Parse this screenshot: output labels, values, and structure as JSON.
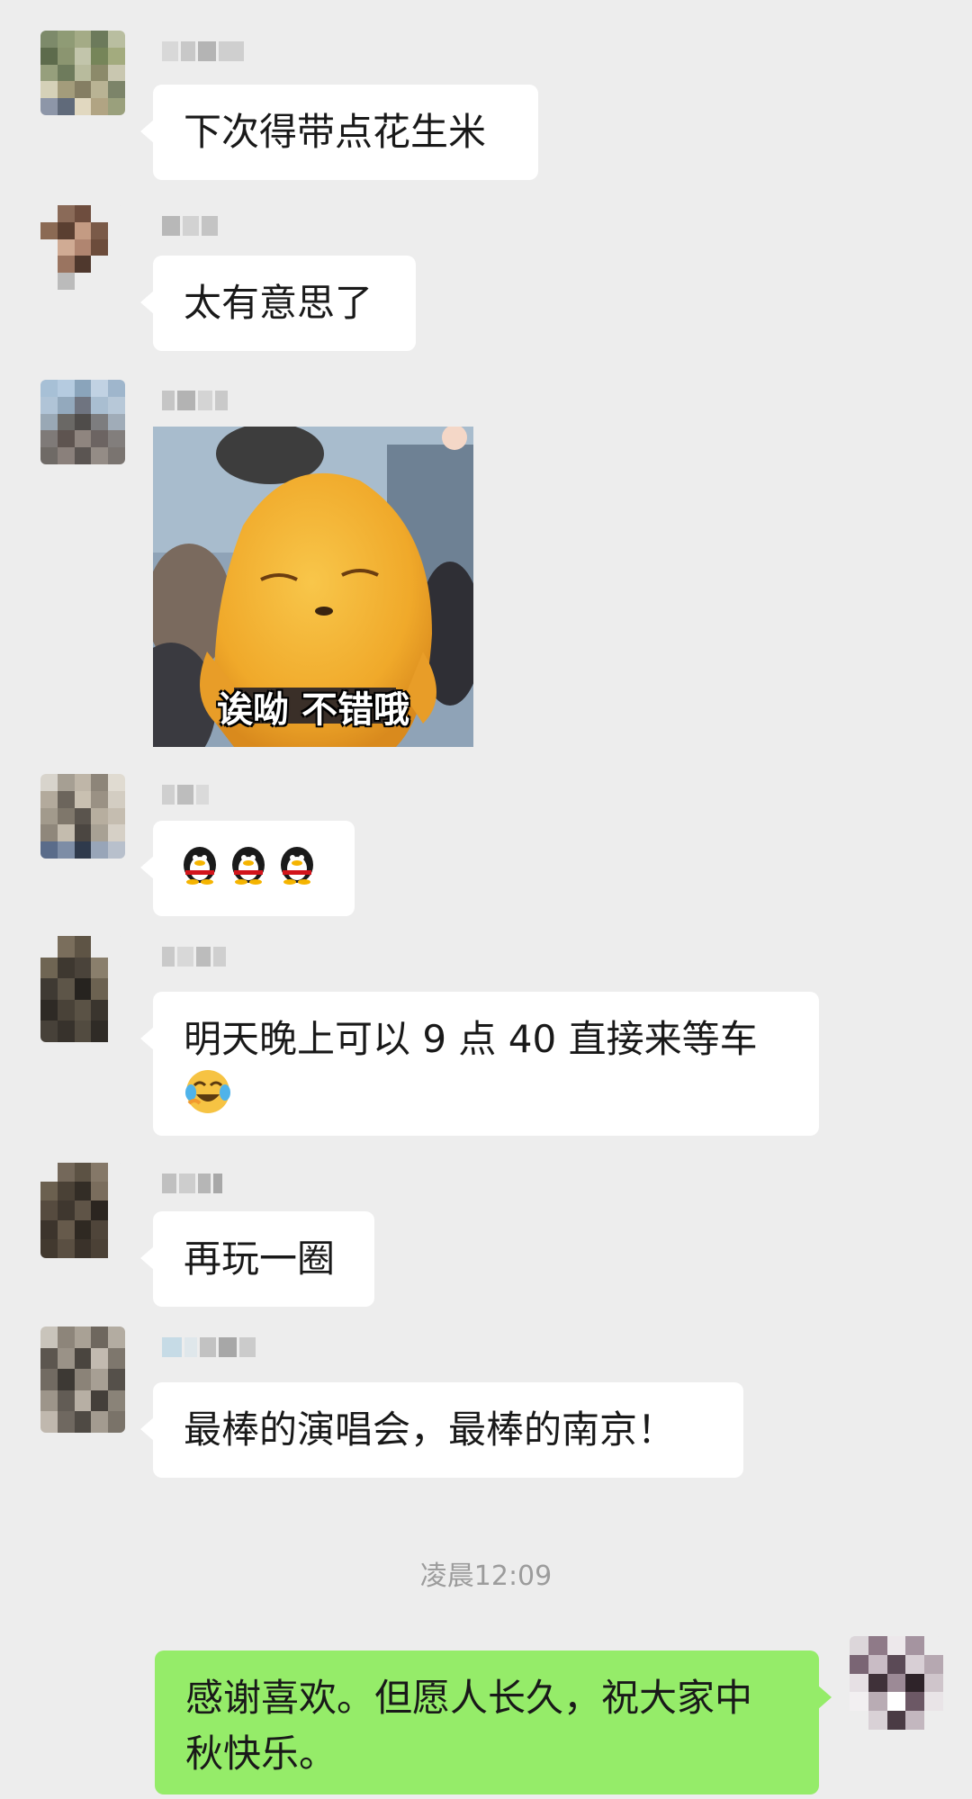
{
  "chat": {
    "messages": [
      {
        "text": "下次得带点花生米"
      },
      {
        "text": "太有意思了"
      },
      {
        "sticker_caption": "诶呦 不错哦"
      },
      {
        "emoji": "penguin-icon x3"
      },
      {
        "text_line1": "明天晚上可以 9 点 40 直接来等车"
      },
      {
        "text": "再玩一圈"
      },
      {
        "text": "最棒的演唱会，最棒的南京！"
      }
    ],
    "timestamp": "凌晨12:09",
    "own_message": {
      "line1": "感谢喜欢。但愿人长久，祝大家中",
      "line2": "秋快乐。"
    }
  },
  "colors": {
    "background": "#ededed",
    "incoming_bubble": "#ffffff",
    "outgoing_bubble": "#95ec69",
    "timestamp": "#9c9c9c"
  }
}
